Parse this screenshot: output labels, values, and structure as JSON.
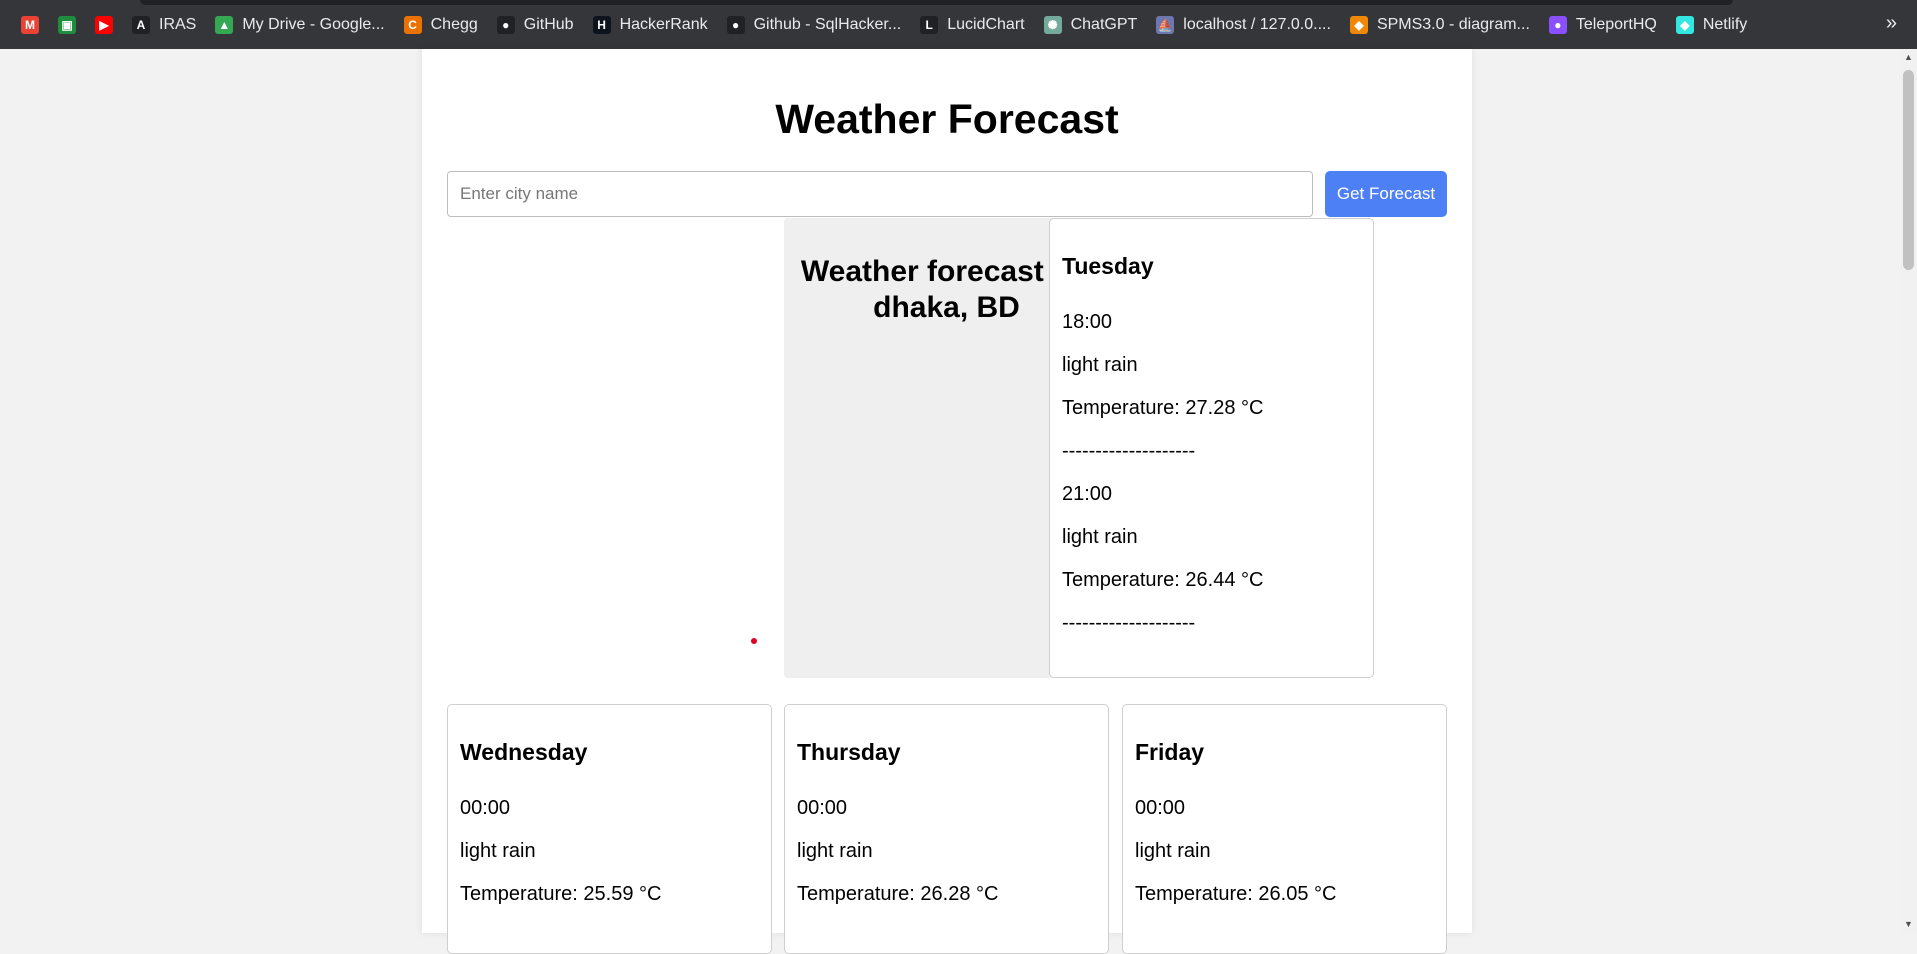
{
  "bookmarks": [
    {
      "label": "",
      "icon": "gmail-icon",
      "color": "#ea4335",
      "glyph": "M"
    },
    {
      "label": "",
      "icon": "classroom-icon",
      "color": "#1e8e3e",
      "glyph": "▣"
    },
    {
      "label": "",
      "icon": "youtube-icon",
      "color": "#ff0000",
      "glyph": "▶"
    },
    {
      "label": "IRAS",
      "icon": "iras-icon",
      "color": "#202124",
      "glyph": "A"
    },
    {
      "label": "My Drive - Google...",
      "icon": "google-drive-icon",
      "color": "#34a853",
      "glyph": "▲"
    },
    {
      "label": "Chegg",
      "icon": "chegg-icon",
      "color": "#eb7100",
      "glyph": "C"
    },
    {
      "label": "GitHub",
      "icon": "github-icon",
      "color": "#202124",
      "glyph": "●"
    },
    {
      "label": "HackerRank",
      "icon": "hackerrank-icon",
      "color": "#0e141e",
      "glyph": "H"
    },
    {
      "label": "Github - SqlHacker...",
      "icon": "github-icon",
      "color": "#202124",
      "glyph": "●"
    },
    {
      "label": "LucidChart",
      "icon": "lucidchart-icon",
      "color": "#202124",
      "glyph": "L"
    },
    {
      "label": "ChatGPT",
      "icon": "chatgpt-icon",
      "color": "#74aa9c",
      "glyph": "✺"
    },
    {
      "label": "localhost / 127.0.0....",
      "icon": "phpmyadmin-icon",
      "color": "#6c78af",
      "glyph": "⛵"
    },
    {
      "label": "SPMS3.0 - diagram...",
      "icon": "drawio-icon",
      "color": "#f08705",
      "glyph": "◆"
    },
    {
      "label": "TeleportHQ",
      "icon": "teleporthq-icon",
      "color": "#8a4fff",
      "glyph": "●"
    },
    {
      "label": "Netlify",
      "icon": "netlify-icon",
      "color": "#32e6e2",
      "glyph": "◆"
    }
  ],
  "overflow_glyph": "»",
  "title": "Weather Forecast",
  "search": {
    "placeholder": "Enter city name",
    "value": ""
  },
  "button_label": "Get Forecast",
  "location_heading": "Weather forecast for dhaka, BD",
  "days": [
    {
      "day": "Tuesday",
      "entries": [
        {
          "time": "18:00",
          "desc": "light rain",
          "temp": "Temperature: 27.28 °C",
          "sep": "--------------------"
        },
        {
          "time": "21:00",
          "desc": "light rain",
          "temp": "Temperature: 26.44 °C",
          "sep": "--------------------"
        }
      ]
    },
    {
      "day": "Wednesday",
      "entries": [
        {
          "time": "00:00",
          "desc": "light rain",
          "temp": "Temperature: 25.59 °C"
        }
      ]
    },
    {
      "day": "Thursday",
      "entries": [
        {
          "time": "00:00",
          "desc": "light rain",
          "temp": "Temperature: 26.28 °C"
        }
      ]
    },
    {
      "day": "Friday",
      "entries": [
        {
          "time": "00:00",
          "desc": "light rain",
          "temp": "Temperature: 26.05 °C"
        }
      ]
    }
  ],
  "colors": {
    "accent": "#4d7ff5",
    "bookmarks_bg": "#35363a",
    "page_bg": "#f2f2f2"
  }
}
